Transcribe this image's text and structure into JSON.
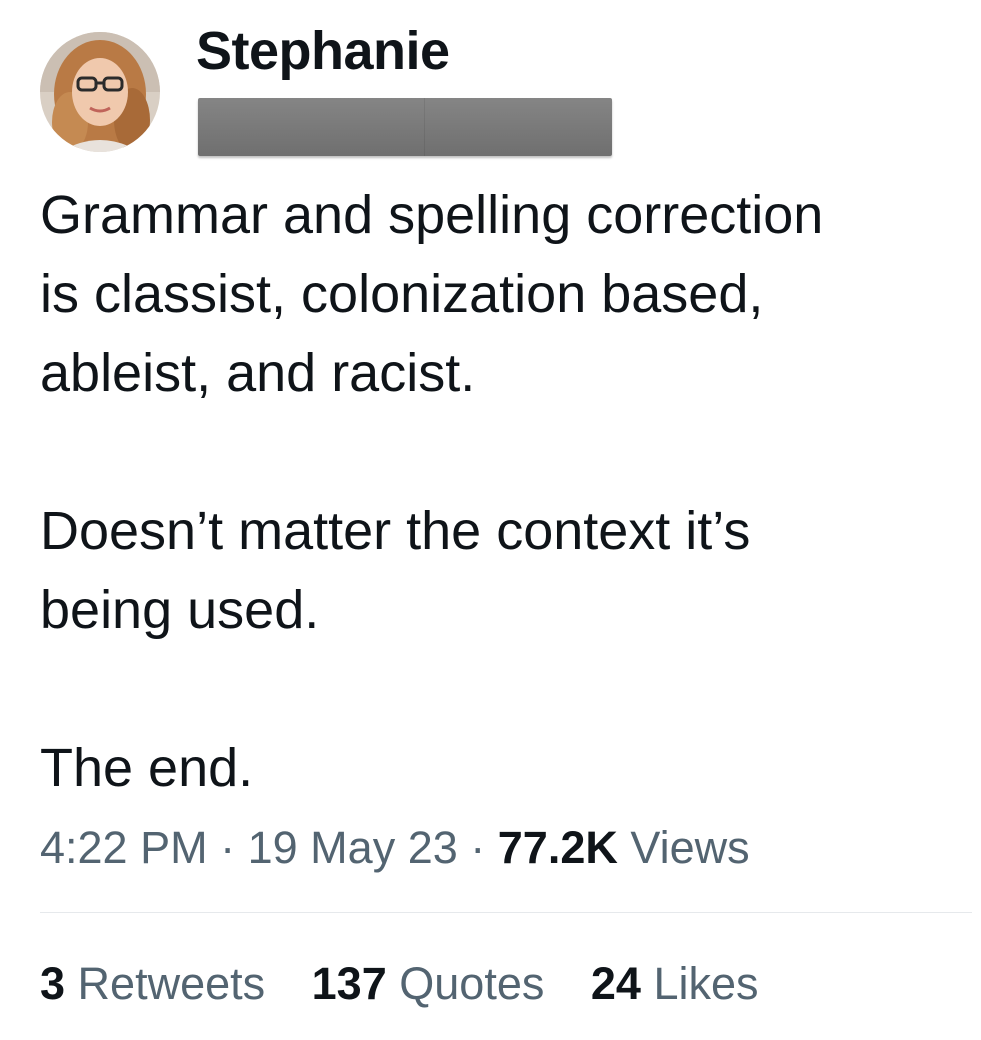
{
  "author": {
    "display_name": "Stephanie",
    "handle_redacted": true,
    "avatar": "profile-photo"
  },
  "tweet": {
    "paragraphs": [
      "Grammar and spelling correction\nis classist, colonization based,\nableist, and racist.",
      "Doesn’t matter the context it’s\nbeing used.",
      "The end."
    ]
  },
  "meta": {
    "time": "4:22 PM",
    "separator": "·",
    "date": "19 May 23",
    "views_count": "77.2K",
    "views_label": "Views"
  },
  "stats": {
    "retweets_count": "3",
    "retweets_label": "Retweets",
    "quotes_count": "137",
    "quotes_label": "Quotes",
    "likes_count": "24",
    "likes_label": "Likes"
  },
  "colors": {
    "primary_text": "#0f1419",
    "secondary_text": "#536471",
    "divider": "#e6e9ec",
    "redaction": "#7a7a7a"
  }
}
